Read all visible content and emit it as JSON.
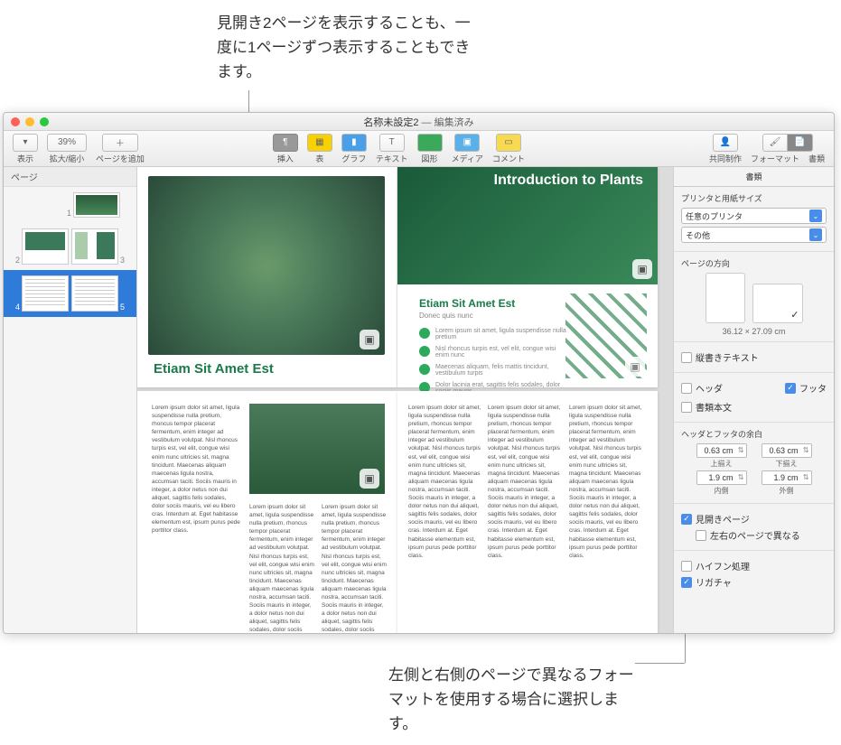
{
  "callouts": {
    "top": "見開き2ページを表示することも、一度に1ページずつ表示することもできます。",
    "bottom": "左側と右側のページで異なるフォーマットを使用する場合に選択します。"
  },
  "window": {
    "title_doc": "名称未設定2",
    "title_suffix": " — 編集済み"
  },
  "toolbar": {
    "view": "表示",
    "zoom_value": "39%",
    "zoom_label": "拡大/縮小",
    "add_page": "ページを追加",
    "insert": "挿入",
    "table": "表",
    "chart": "グラフ",
    "text": "テキスト",
    "shape": "図形",
    "media": "メディア",
    "comment": "コメント",
    "collaborate": "共同制作",
    "format": "フォーマット",
    "document": "書類"
  },
  "thumbs": {
    "header": "ページ",
    "rows": [
      {
        "nums": [
          "",
          "1"
        ]
      },
      {
        "nums": [
          "2",
          "3"
        ]
      },
      {
        "nums": [
          "4",
          "5"
        ],
        "selected": true
      }
    ]
  },
  "pages": {
    "p1_heading": "Etiam Sit Amet Est",
    "p2_hero_title": "Introduction to Plants",
    "p2_heading": "Etiam Sit Amet Est",
    "p2_sub": "Donec quis nunc",
    "bullets": [
      "Lorem ipsum sit amet, ligula suspendisse nulla pretium",
      "Nisl rhoncus turpis est, vel elit, congue wisi enim nunc",
      "Maecenas aliquam, felis mattis tincidunt, vestibulum turpis",
      "Dolor lacinia erat, sagittis felis sodales, dolor sociis mauris"
    ],
    "body_lorem": "Lorem ipsum dolor sit amet, ligula suspendisse nulla pretium, rhoncus tempor placerat fermentum, enim integer ad vestibulum volutpat. Nisl rhoncus turpis est, vel elit, congue wisi enim nunc ultricies sit, magna tincidunt. Maecenas aliquam maecenas ligula nostra, accumsan taciti. Sociis mauris in integer, a dolor netus non dui aliquet, sagittis felis sodales, dolor sociis mauris, vel eu libero cras. Interdum at. Eget habitasse elementum est, ipsum purus pede porttitor class."
  },
  "inspector": {
    "tab_document": "書類",
    "printer_label": "プリンタと用紙サイズ",
    "printer_value": "任意のプリンタ",
    "paper_value": "その他",
    "orientation_label": "ページの方向",
    "dimensions": "36.12 × 27.09 cm",
    "vertical_text": "縦書きテキスト",
    "header": "ヘッダ",
    "footer": "フッタ",
    "document_body": "書類本文",
    "margins_label": "ヘッダとフッタの余白",
    "margin_top": {
      "value": "0.63 cm",
      "label": "上揃え"
    },
    "margin_bottom": {
      "value": "0.63 cm",
      "label": "下揃え"
    },
    "margin_inner": {
      "value": "1.9 cm",
      "label": "内側"
    },
    "margin_outer": {
      "value": "1.9 cm",
      "label": "外側"
    },
    "facing_pages": "見開きページ",
    "diff_lr": "左右のページで異なる",
    "hyphenation": "ハイフン処理",
    "ligatures": "リガチャ"
  }
}
